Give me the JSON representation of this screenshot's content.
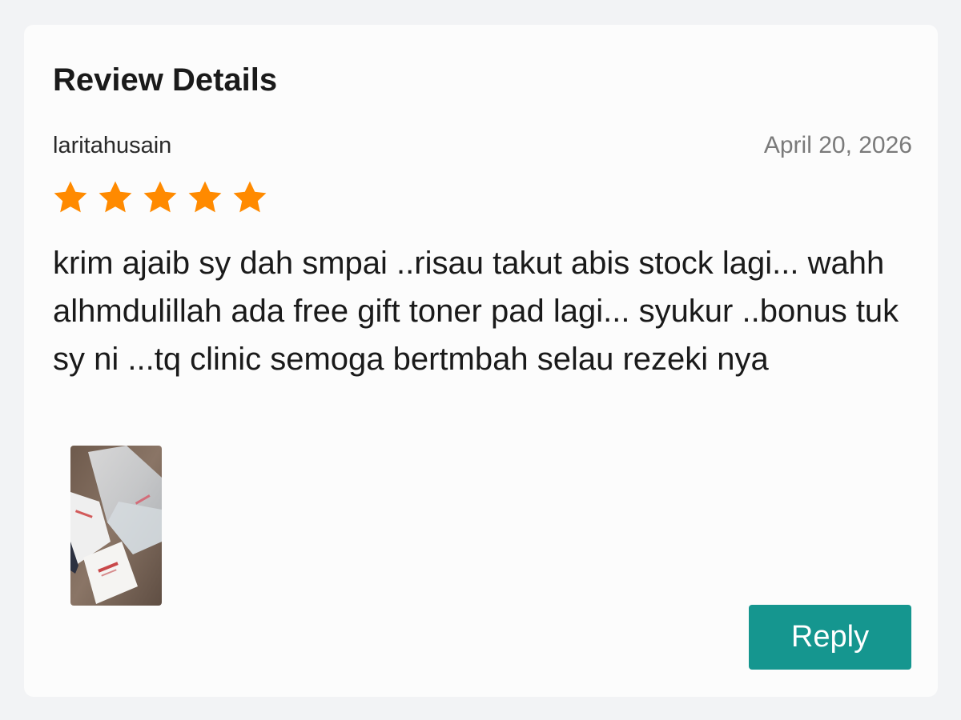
{
  "review": {
    "heading": "Review Details",
    "reviewer_name": "laritahusain",
    "date": "April 20, 2026",
    "rating": 5,
    "rating_max": 5,
    "star_color": "#ff8a00",
    "text": "krim ajaib sy dah smpai ..risau takut abis stock lagi... wahh alhmdulillah ada free gift toner pad lagi... syukur ..bonus tuk sy ni ...tq clinic semoga bertmbah selau rezeki nya",
    "photo_icon": "product-photo"
  },
  "actions": {
    "reply_label": "Reply",
    "reply_color": "#15968f"
  }
}
